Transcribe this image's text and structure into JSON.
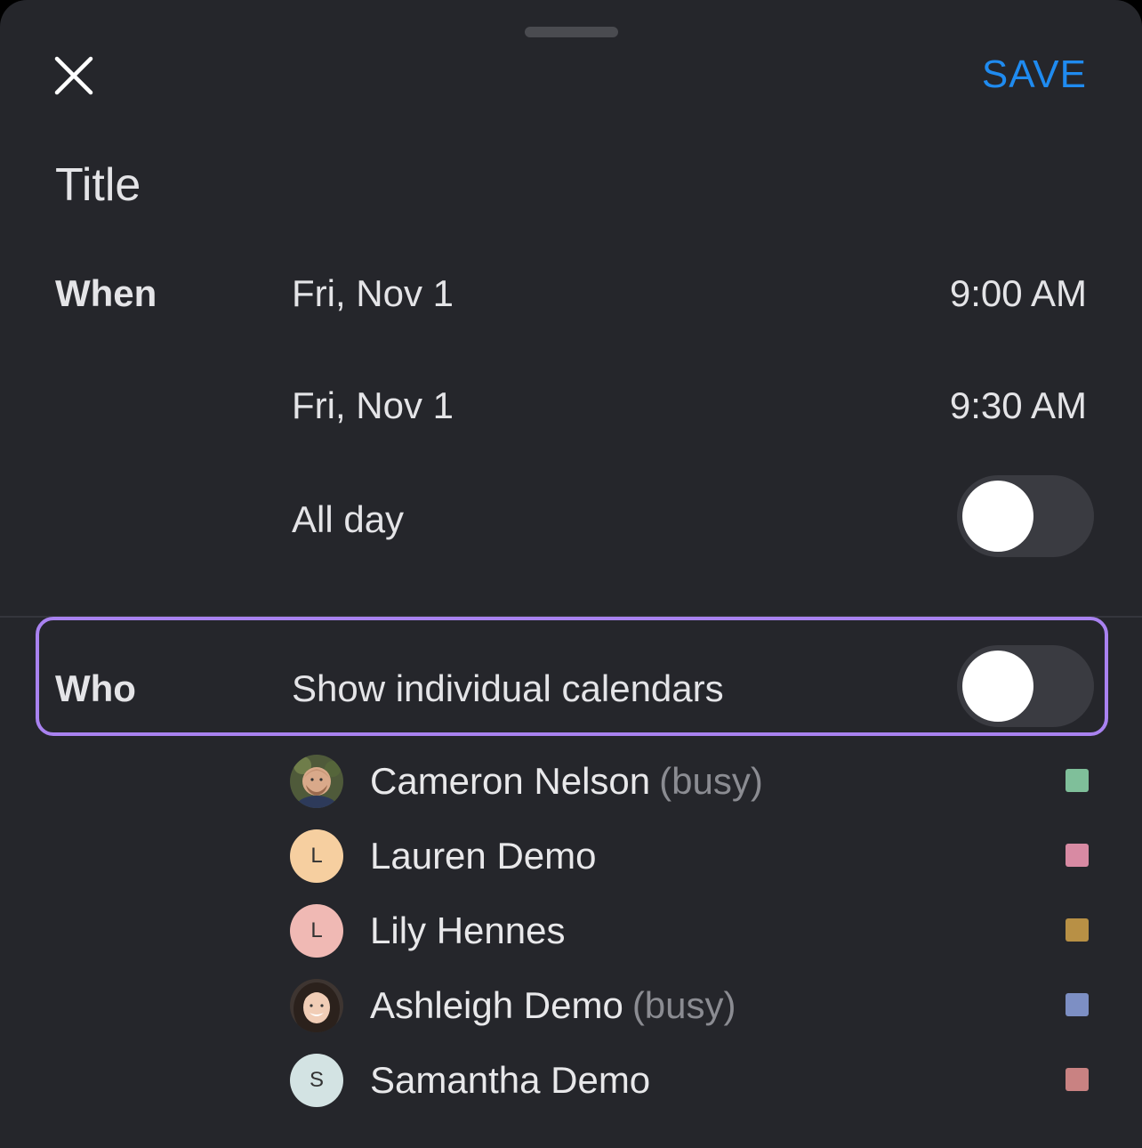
{
  "header": {
    "save_label": "SAVE",
    "close_icon": "close-icon",
    "accent_color": "#1f8bf0"
  },
  "title_placeholder": "Title",
  "when": {
    "label": "When",
    "start_date": "Fri, Nov 1",
    "start_time": "9:00 AM",
    "end_date": "Fri, Nov 1",
    "end_time": "9:30 AM",
    "all_day_label": "All day",
    "all_day_on": false
  },
  "who": {
    "label": "Who",
    "show_calendars_label": "Show individual calendars",
    "show_calendars_on": false,
    "highlight_color": "#a982f0",
    "members": [
      {
        "name": "Cameron Nelson",
        "status": "(busy)",
        "avatar": "photo",
        "initial": "",
        "avatar_color": "#6b7a55",
        "swatch": "#7fbf9a"
      },
      {
        "name": "Lauren Demo",
        "status": "",
        "avatar": "initial",
        "initial": "L",
        "avatar_color": "#f6cfa0",
        "swatch": "#d88aa3"
      },
      {
        "name": "Lily Hennes",
        "status": "",
        "avatar": "initial",
        "initial": "L",
        "avatar_color": "#f0b9b4",
        "swatch": "#b89045"
      },
      {
        "name": "Ashleigh Demo",
        "status": "(busy)",
        "avatar": "photo",
        "initial": "",
        "avatar_color": "#5a4a42",
        "swatch": "#7d8fc4"
      },
      {
        "name": "Samantha Demo",
        "status": "",
        "avatar": "initial",
        "initial": "S",
        "avatar_color": "#d3e3e3",
        "swatch": "#c98282"
      }
    ]
  }
}
